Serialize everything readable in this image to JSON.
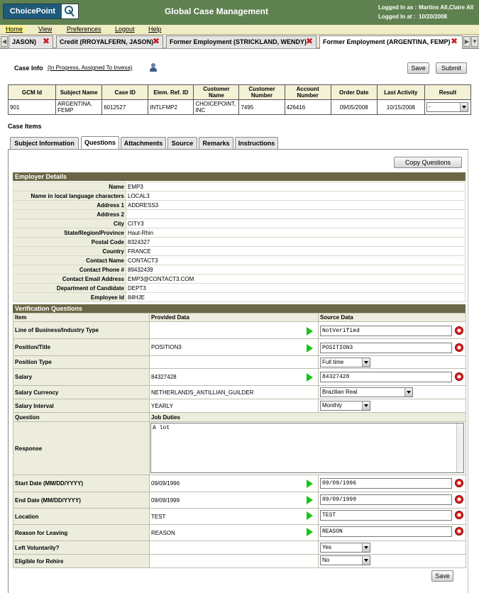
{
  "header": {
    "logo_text": "ChoicePoint",
    "title": "Global Case Management",
    "logged_in_as_label": "Logged In as :",
    "logged_in_as_value": "Martins All,Claire All",
    "logged_in_at_label": "Logged In at :",
    "logged_in_at_value": "10/20/2008"
  },
  "menu": {
    "home": "Home",
    "view": "View",
    "preferences": "Preferences",
    "logout": "Logout",
    "help": "Help"
  },
  "window_tabs": [
    "JASON)",
    "Credit (RROYALFERN, JASON)",
    "Former Employment (STRICKLAND, WENDY)",
    "Former Employment (ARGENTINA, FEMP)"
  ],
  "case_info": {
    "label": "Case Info",
    "status": "(In Progress,  Assigned To Invexa)",
    "save_label": "Save",
    "submit_label": "Submit"
  },
  "case_summary": {
    "columns": [
      "GCM Id",
      "Subject Name",
      "Case ID",
      "Elem. Ref. ID",
      "Customer Name",
      "Customer Number",
      "Account Number",
      "Order Date",
      "Last Activity",
      "Result"
    ],
    "row": [
      "901",
      "ARGENTINA, FEMP",
      "6012527",
      "INTLFMP2",
      "CHOICEPOINT, INC",
      "7495",
      "426416",
      "09/05/2008",
      "10/15/2008",
      "-"
    ]
  },
  "case_items": {
    "label": "Case Items",
    "tabs": [
      "Subject Information",
      "Questions",
      "Attachments",
      "Source",
      "Remarks",
      "Instructions"
    ],
    "copy_questions_label": "Copy Questions"
  },
  "employer": {
    "title": "Employer Details",
    "rows": [
      {
        "label": "Name",
        "value": "EMP3"
      },
      {
        "label": "Name in local language characters",
        "value": "LOCAL3"
      },
      {
        "label": "Address 1",
        "value": "ADDRESS3"
      },
      {
        "label": "Address 2",
        "value": ""
      },
      {
        "label": "City",
        "value": "CITY3"
      },
      {
        "label": "State/Region/Province",
        "value": "Haut-Rhin"
      },
      {
        "label": "Postal Code",
        "value": "8324327"
      },
      {
        "label": "Country",
        "value": "FRANCE"
      },
      {
        "label": "Contact Name",
        "value": "CONTACT3"
      },
      {
        "label": "Contact Phone #",
        "value": "89432439"
      },
      {
        "label": "Contact Email Address",
        "value": "EMP3@CONTACT3.COM"
      },
      {
        "label": "Department of Candidate",
        "value": "DEPT3"
      },
      {
        "label": "Employee Id",
        "value": "84HJE"
      }
    ]
  },
  "verification": {
    "title": "Verification Questions",
    "col_item": "Item",
    "col_provided": "Provided Data",
    "col_source": "Source Data",
    "line_of_business": {
      "label": "Line of Business/Industry Type",
      "provided": "",
      "source": "NotVerified"
    },
    "position": {
      "label": "Position/Title",
      "provided": "POSITION3",
      "source": "POSITION3"
    },
    "position_type": {
      "label": "Position Type",
      "provided": "",
      "source": "Full time"
    },
    "salary": {
      "label": "Salary",
      "provided": "84327428",
      "source": "84327428"
    },
    "salary_currency": {
      "label": "Salary Currency",
      "provided": "NETHERLANDS_ANTILLIAN_GUILDER",
      "source": "Brazilian Real"
    },
    "salary_interval": {
      "label": "Salary Interval",
      "provided": "YEARLY",
      "source": "Monthly"
    },
    "question_label": "Question",
    "question_value": "Job Duties",
    "response_label": "Response",
    "response_value": "A lot",
    "start_date": {
      "label": "Start Date (MM/DD/YYYY)",
      "provided": "09/09/1996",
      "source": "09/09/1996"
    },
    "end_date": {
      "label": "End Date (MM/DD/YYYY)",
      "provided": "09/09/1999",
      "source": "09/09/1999"
    },
    "location": {
      "label": "Location",
      "provided": "TEST",
      "source": "TEST"
    },
    "reason": {
      "label": "Reason for Leaving",
      "provided": "REASON",
      "source": "REASON"
    },
    "left_voluntarily": {
      "label": "Left Voluntarily?",
      "provided": "",
      "source": "Yes"
    },
    "eligible_rehire": {
      "label": "Eligible for Rehire",
      "provided": "",
      "source": "No"
    },
    "save_label": "Save"
  },
  "colors": {
    "header_bg": "#5f8150",
    "menu_bg": "#f0ecc4",
    "section_header": "#6b6645",
    "label_bg": "#ededde",
    "arrow_green": "#19c419",
    "close_red": "#c81e1e"
  },
  "icons": {
    "copy_source": "green-play-arrow-icon",
    "clear": "red-clear-icon",
    "tab_close": "red-x-close-icon",
    "person": "person-icon"
  }
}
